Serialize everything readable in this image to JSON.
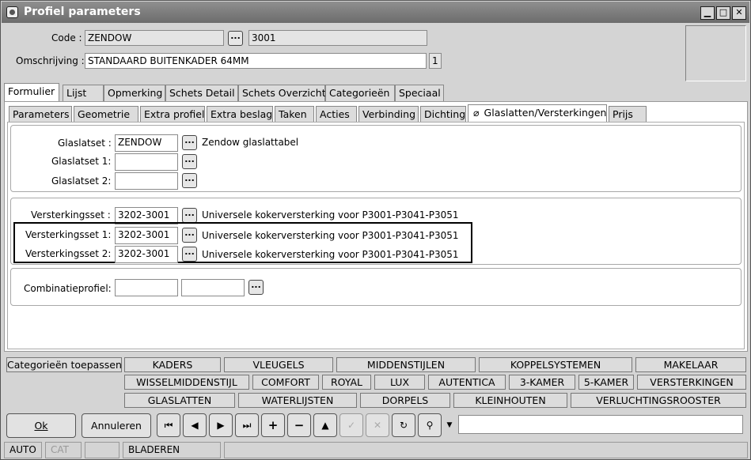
{
  "window": {
    "title": "Profiel parameters"
  },
  "header": {
    "code_label": "Code :",
    "code_value": "ZENDOW",
    "code_num": "3001",
    "omschrijving_label": "Omschrijving :",
    "omschrijving_value": "STANDAARD BUITENKADER 64MM",
    "omschrijving_num": "1",
    "dots": "..."
  },
  "main_tabs": [
    "Formulier",
    "Lijst",
    "Opmerking",
    "Schets Detail",
    "Schets Overzicht",
    "Categorieën",
    "Speciaal"
  ],
  "sub_tabs": [
    "Parameters",
    "Geometrie",
    "Extra profiel",
    "Extra beslag",
    "Taken",
    "Acties",
    "Verbinding",
    "Dichting",
    "Glaslatten/Versterkingen",
    "Prijs"
  ],
  "glaslat": {
    "set_label": "Glaslatset :",
    "set_value": "ZENDOW",
    "set_desc": "Zendow glaslattabel",
    "set1_label": "Glaslatset 1:",
    "set2_label": "Glaslatset 2:"
  },
  "versterking": {
    "set_label": "Versterkingsset :",
    "set1_label": "Versterkingsset 1:",
    "set2_label": "Versterkingsset 2:",
    "value": "3202-3001",
    "desc": "Universele kokerversterking voor P3001-P3041-P3051"
  },
  "combinatie": {
    "label": "Combinatieprofiel:"
  },
  "categories": {
    "apply": "Categorieën toepassen",
    "row1": [
      "KADERS",
      "VLEUGELS",
      "MIDDENSTIJLEN",
      "KOPPELSYSTEMEN",
      "MAKELAAR"
    ],
    "row2": [
      "WISSELMIDDENSTIJL",
      "COMFORT",
      "ROYAL",
      "LUX",
      "AUTENTICA",
      "3-KAMER",
      "5-KAMER",
      "VERSTERKINGEN"
    ],
    "row3": [
      "GLASLATTEN",
      "WATERLIJSTEN",
      "DORPELS",
      "KLEINHOUTEN",
      "VERLUCHTINGSROOSTER"
    ]
  },
  "buttons": {
    "ok": "Ok",
    "cancel": "Annuleren"
  },
  "status": {
    "mode": "AUTO",
    "cat": "CAT",
    "state": "BLADEREN"
  }
}
